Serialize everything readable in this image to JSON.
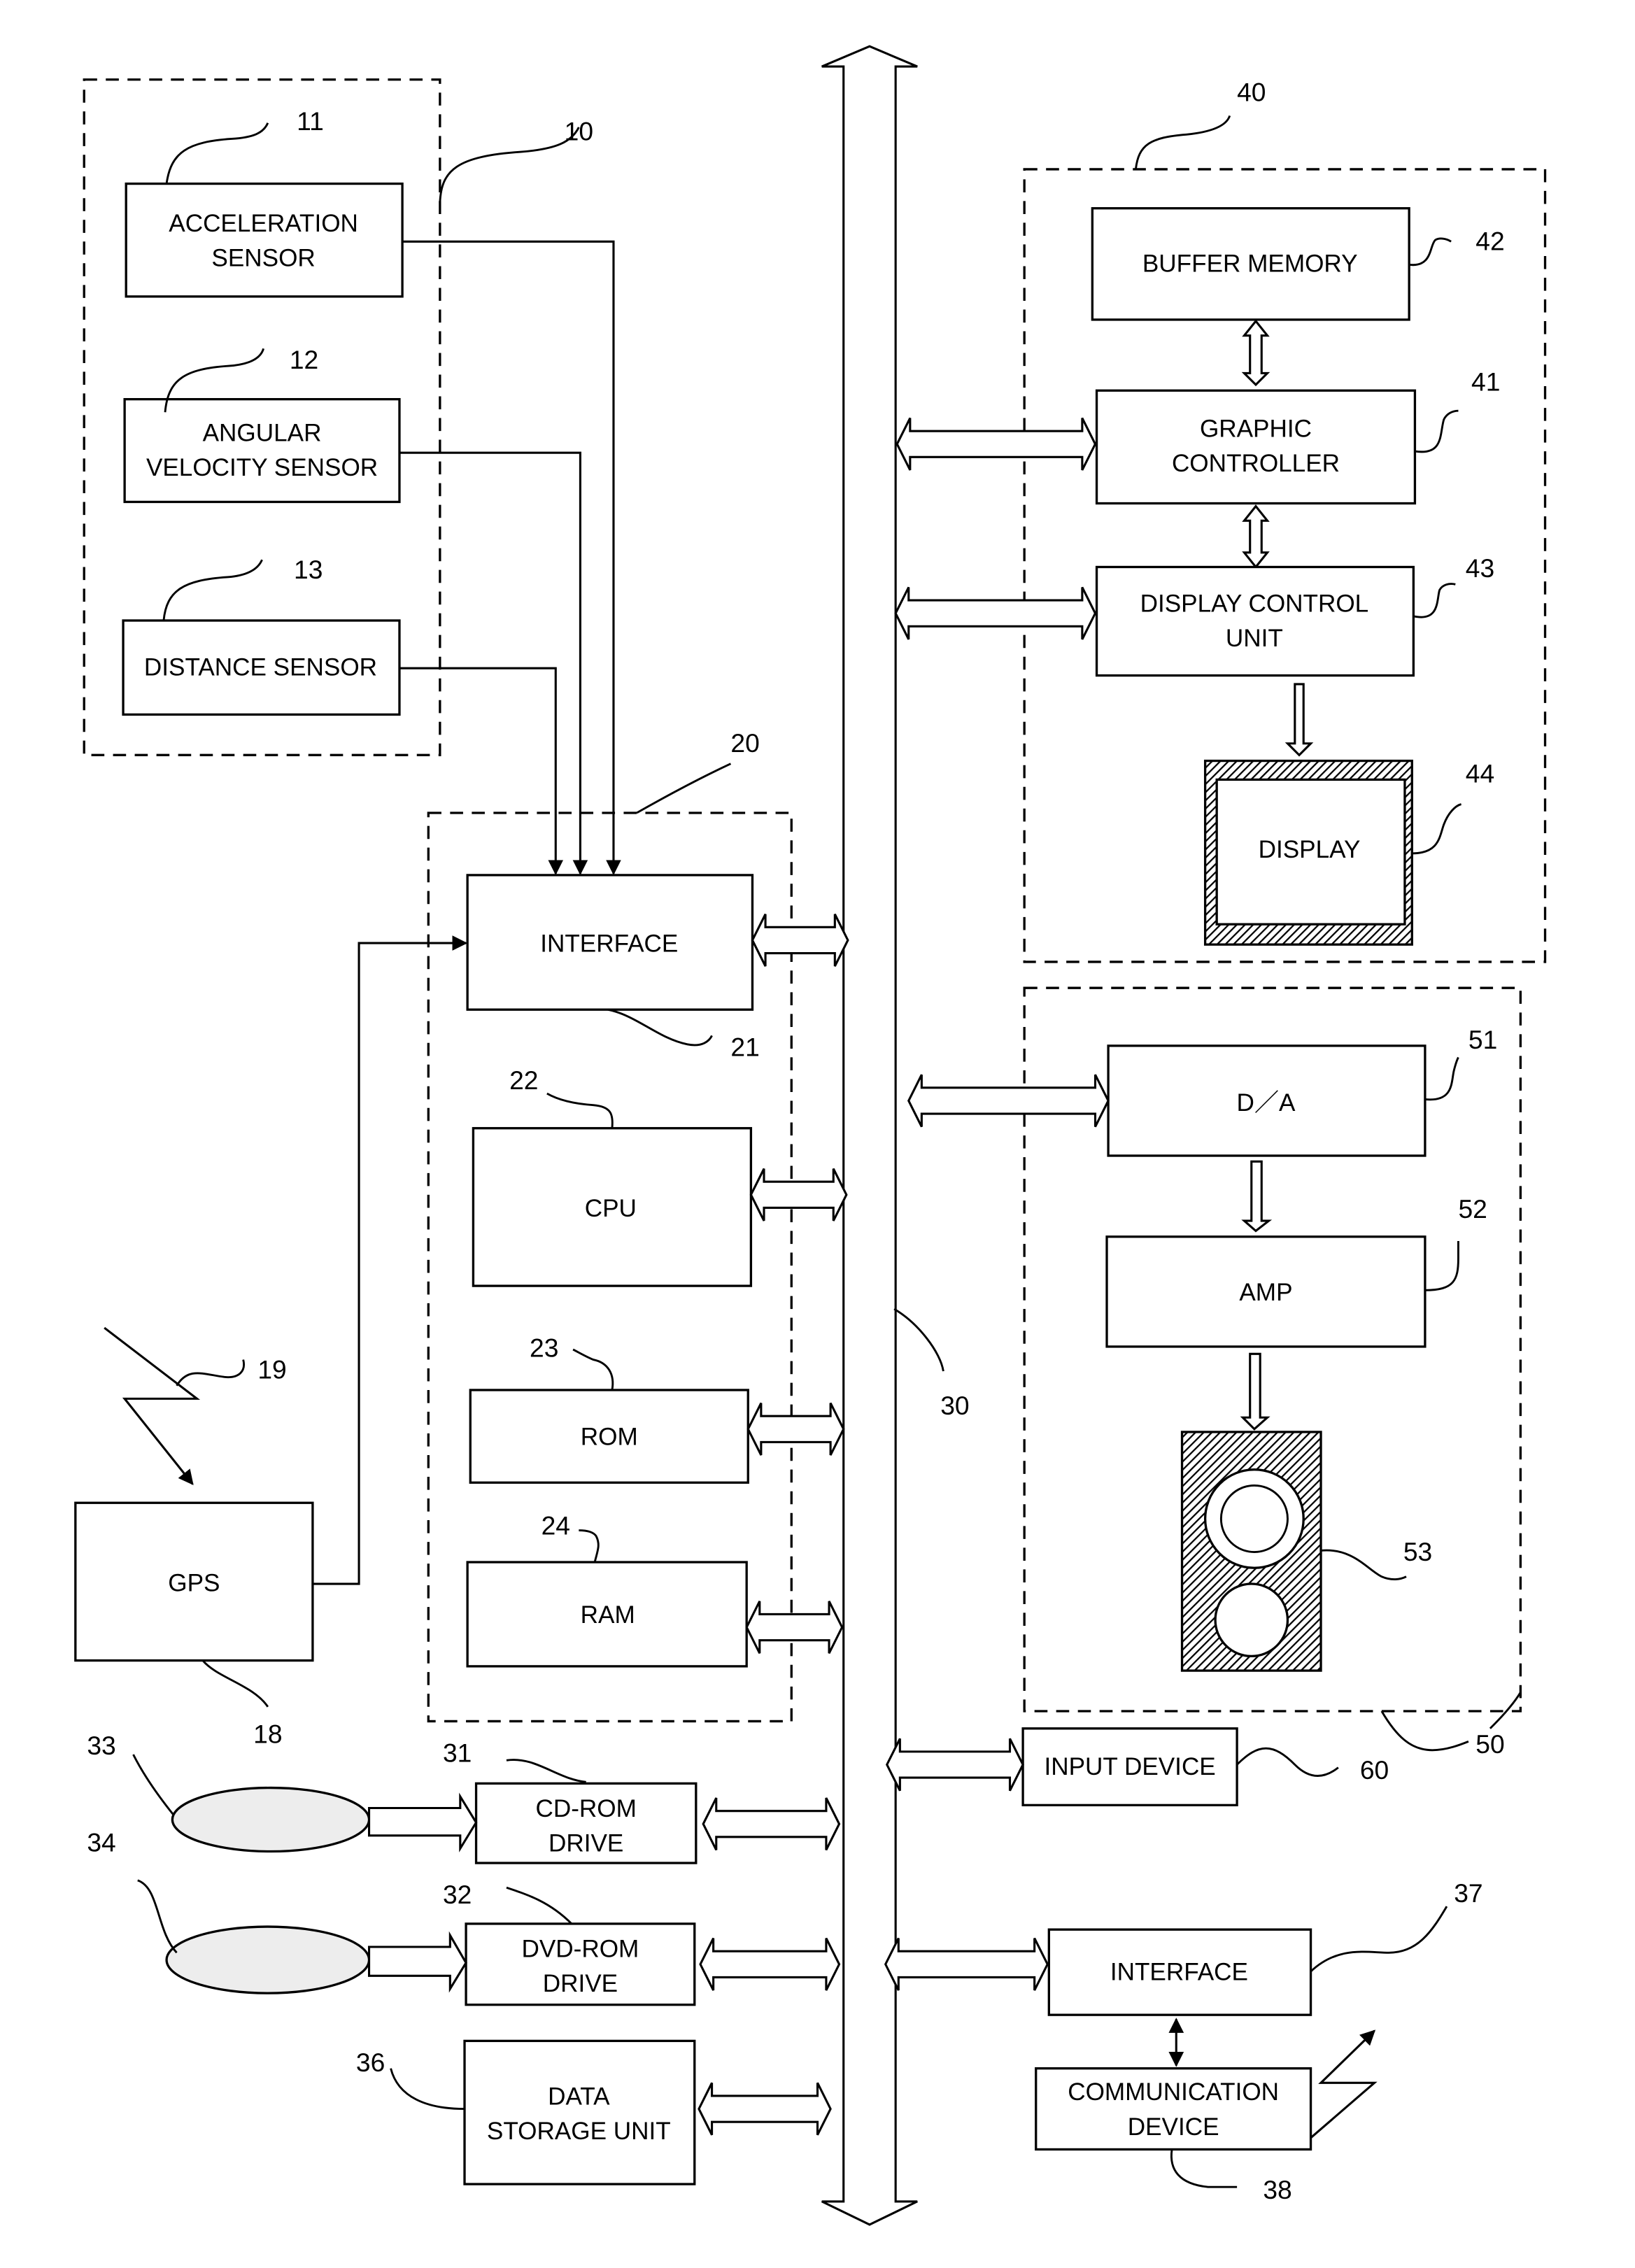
{
  "diagram": {
    "type": "block-diagram",
    "groups": {
      "sensors": {
        "ref": "10"
      },
      "controller": {
        "ref": "20"
      },
      "display_unit": {
        "ref": "40"
      },
      "audio_unit": {
        "ref": "50"
      }
    },
    "bus": {
      "ref": "30"
    },
    "blocks": {
      "acceleration_sensor": {
        "line1": "ACCELERATION",
        "line2": "SENSOR",
        "ref": "11"
      },
      "angular_velocity_sensor": {
        "line1": "ANGULAR",
        "line2": "VELOCITY SENSOR",
        "ref": "12"
      },
      "distance_sensor": {
        "line1": "DISTANCE SENSOR",
        "ref": "13"
      },
      "gps": {
        "line1": "GPS",
        "ref": "18",
        "antenna_ref": "19"
      },
      "interface_21": {
        "line1": "INTERFACE",
        "ref": "21"
      },
      "cpu": {
        "line1": "CPU",
        "ref": "22"
      },
      "rom": {
        "line1": "ROM",
        "ref": "23"
      },
      "ram": {
        "line1": "RAM",
        "ref": "24"
      },
      "cdrom_drive": {
        "line1": "CD-ROM",
        "line2": "DRIVE",
        "ref": "31",
        "media_ref": "33"
      },
      "dvdrom_drive": {
        "line1": "DVD-ROM",
        "line2": "DRIVE",
        "ref": "32",
        "media_ref": "34"
      },
      "data_storage": {
        "line1": "DATA",
        "line2": "STORAGE UNIT",
        "ref": "36"
      },
      "buffer_memory": {
        "line1": "BUFFER MEMORY",
        "ref": "42"
      },
      "graphic_controller": {
        "line1": "GRAPHIC",
        "line2": "CONTROLLER",
        "ref": "41"
      },
      "display_control_unit": {
        "line1": "DISPLAY CONTROL",
        "line2": "UNIT",
        "ref": "43"
      },
      "display": {
        "line1": "DISPLAY",
        "ref": "44"
      },
      "da_converter": {
        "line1": "D／A",
        "ref": "51"
      },
      "amp": {
        "line1": "AMP",
        "ref": "52"
      },
      "speaker": {
        "ref": "53"
      },
      "input_device": {
        "line1": "INPUT DEVICE",
        "ref": "60"
      },
      "interface_37": {
        "line1": "INTERFACE",
        "ref": "37"
      },
      "communication_device": {
        "line1": "COMMUNICATION",
        "line2": "DEVICE",
        "ref": "38"
      }
    }
  }
}
